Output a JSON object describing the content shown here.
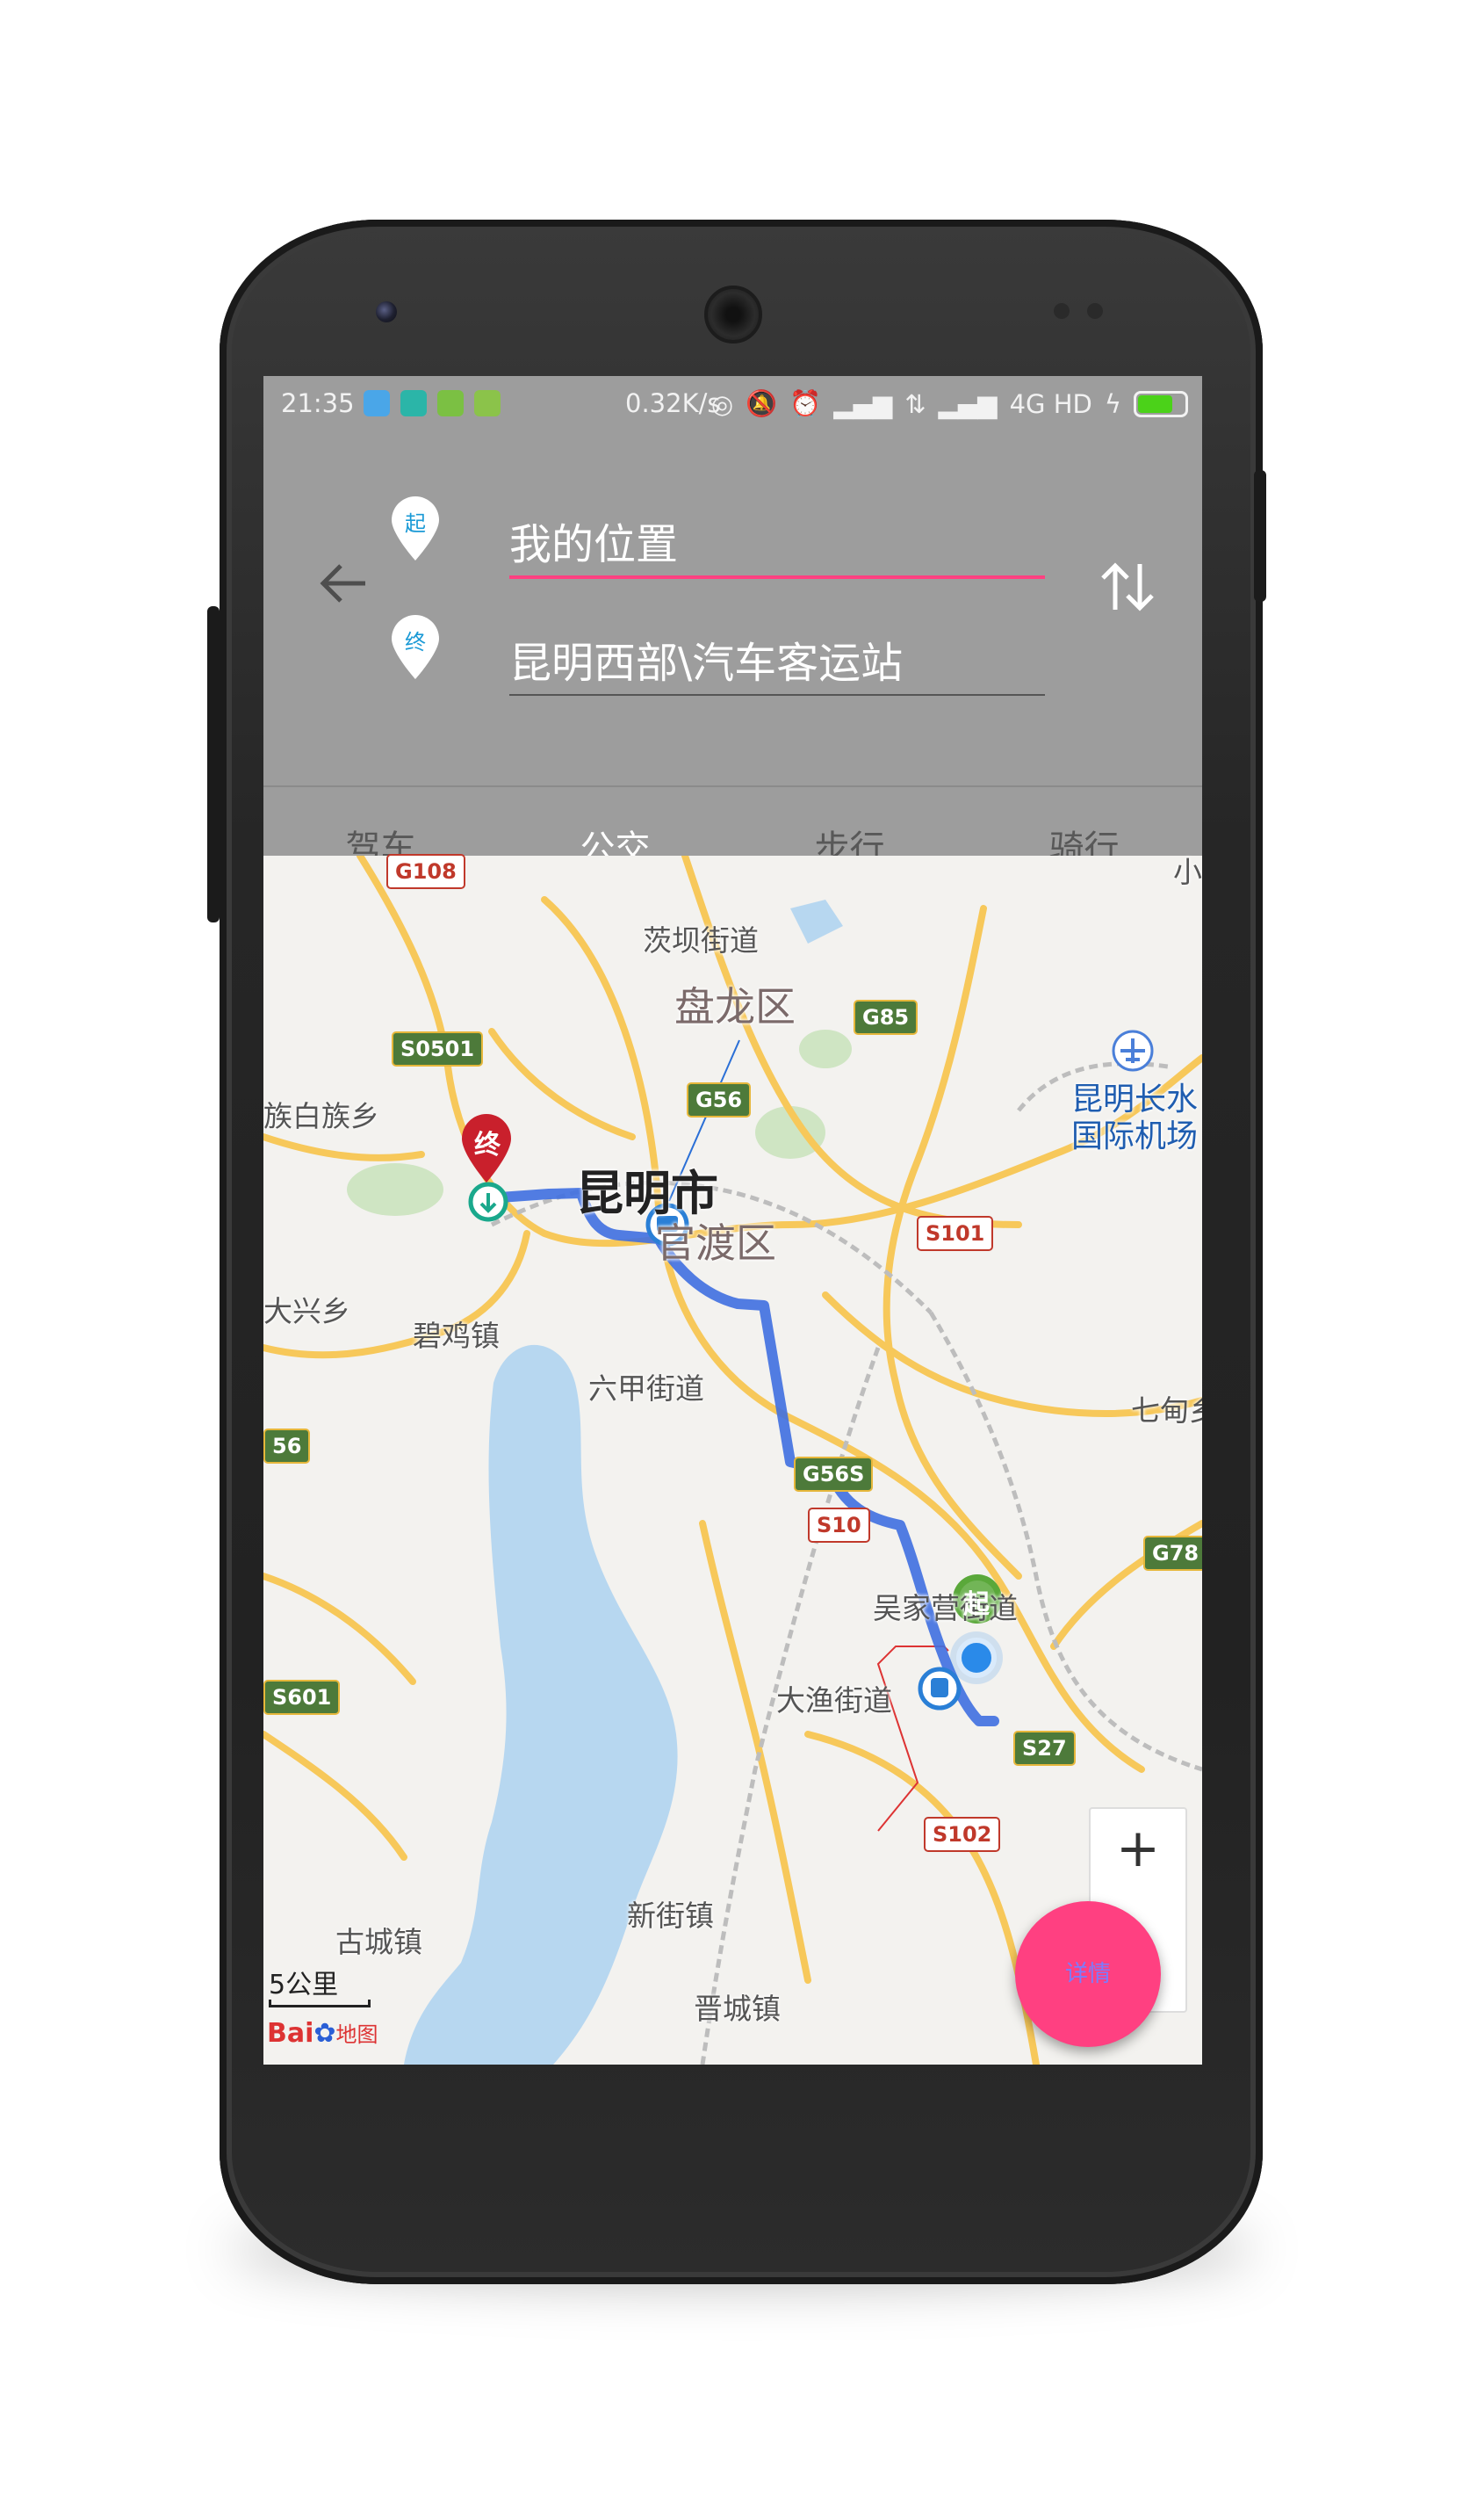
{
  "status_bar": {
    "time": "21:35",
    "net_speed": "0.32K/s",
    "network": "4G HD",
    "battery_level": 0.85
  },
  "route_form": {
    "start_pin_label": "起",
    "end_pin_label": "终",
    "start_value": "我的位置",
    "end_value": "昆明西部\\汽车客运站"
  },
  "tabs": [
    {
      "label": "驾车"
    },
    {
      "label": "公交"
    },
    {
      "label": "步行"
    },
    {
      "label": "骑行"
    }
  ],
  "active_tab": "公交",
  "map": {
    "places": {
      "chaba": "茨坝街道",
      "panlong": "盘龙区",
      "kunming": "昆明市",
      "guandu": "官渡区",
      "bijizhen": "碧鸡镇",
      "liujia": "六甲街道",
      "baizu": "族白族乡",
      "daxing": "大兴乡",
      "airport_1": "昆明长水",
      "airport_2": "国际机场",
      "qidian": "七甸乡",
      "wujiaying": "吴家营街道",
      "dayu": "大渔街道",
      "xinjie": "新街镇",
      "gucheng": "古城镇",
      "jincheng": "晋城镇",
      "xiao": "小"
    },
    "shields": {
      "g108": "G108",
      "s0501": "S0501",
      "g56": "G56",
      "g85": "G85",
      "s101": "S101",
      "g56s": "G56S",
      "s10x": "S10",
      "g78": "G78",
      "s27": "S27",
      "s102": "S102",
      "s601": "S601",
      "s56": "56"
    },
    "start_marker": "起",
    "end_marker": "终",
    "scale": "5公里",
    "logo": {
      "brand": "Bai",
      "suffix": "地图"
    }
  },
  "zoom": {
    "in": "+",
    "out": "−"
  },
  "fab_label": "详情",
  "colors": {
    "accent": "#ff4081",
    "header_bg": "#9d9d9d",
    "route_blue": "#3f6fe0",
    "water": "#b7d7f0",
    "road_yellow": "#f7c85a"
  }
}
